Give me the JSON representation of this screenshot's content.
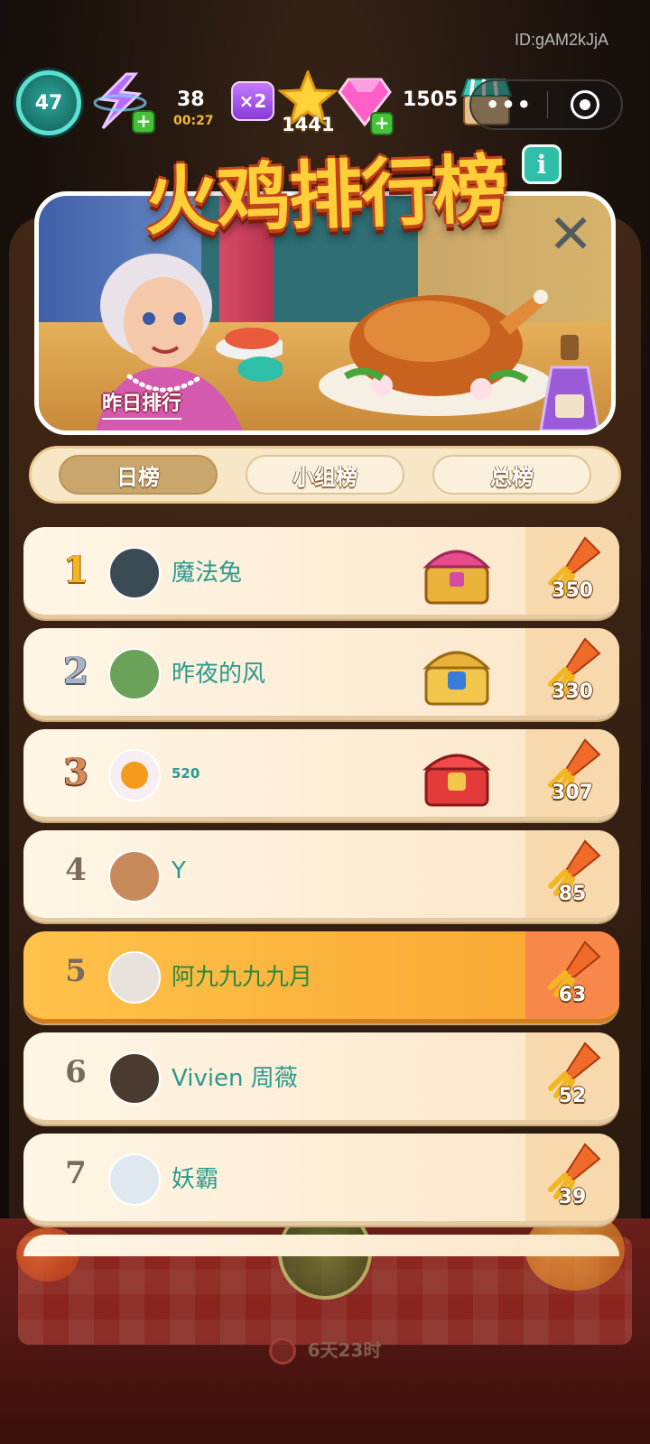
{
  "status_bar": {
    "player_id": "ID:gAM2kJjA"
  },
  "hud": {
    "level": "47",
    "energy_count": "38",
    "energy_timer": "00:27",
    "multiplier": "×2",
    "stars": "1441",
    "gems": "1505",
    "more_label": "•••"
  },
  "title": {
    "text": "火鸡排行榜",
    "info_label": "i",
    "close_label": "✕"
  },
  "banner": {
    "yesterday_label": "昨日排行"
  },
  "tabs": [
    {
      "label": "日榜",
      "active": true
    },
    {
      "label": "小组榜",
      "active": false
    },
    {
      "label": "总榜",
      "active": false
    }
  ],
  "leaderboard": [
    {
      "rank": "1",
      "name": "魔法兔",
      "reward": "350",
      "chest": "pink-chest-icon",
      "avatar_color": "#3a4a55"
    },
    {
      "rank": "2",
      "name": "昨夜的风",
      "reward": "330",
      "chest": "blue-chest-icon",
      "avatar_color": "#6aa25a"
    },
    {
      "rank": "3",
      "name": "520",
      "reward": "307",
      "chest": "red-chest-icon",
      "avatar_color": "#f6eef0"
    },
    {
      "rank": "4",
      "name": "Y",
      "reward": "85",
      "chest": "",
      "avatar_color": "#c88a5a"
    },
    {
      "rank": "5",
      "name": "阿九九九九月",
      "reward": "63",
      "chest": "",
      "avatar_color": "#e8e2dc",
      "is_me": true
    },
    {
      "rank": "6",
      "name": "Vivien 周薇",
      "reward": "52",
      "chest": "",
      "avatar_color": "#4a3a30"
    },
    {
      "rank": "7",
      "name": "妖霸",
      "reward": "39",
      "chest": "",
      "avatar_color": "#dfe8ee"
    }
  ],
  "background": {
    "timer": "6天23时"
  },
  "colors": {
    "accent_teal": "#2b9a8e",
    "highlight_orange": "#f9a632",
    "title_yellow": "#ffcf3a"
  }
}
